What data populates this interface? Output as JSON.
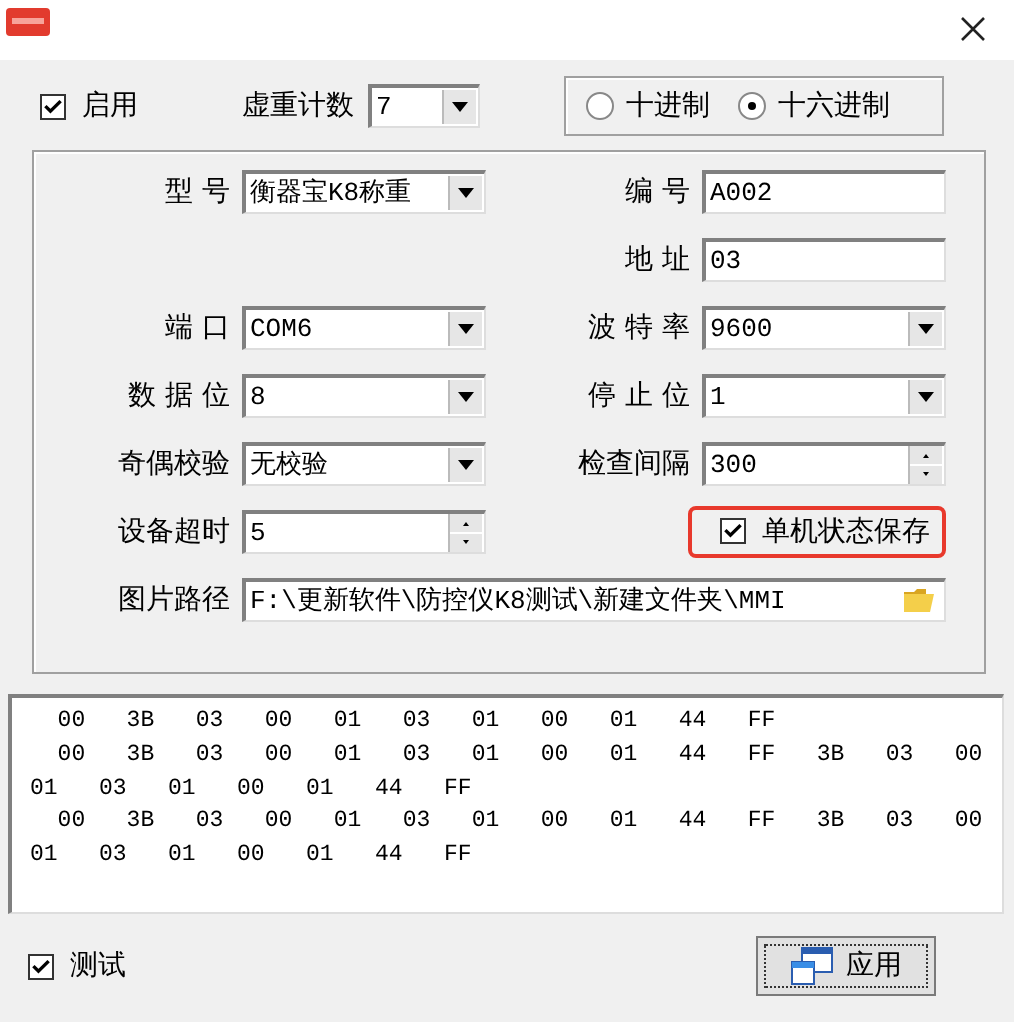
{
  "enable": {
    "label": "启用",
    "checked": true
  },
  "weight_count": {
    "label": "虚重计数",
    "value": "7"
  },
  "radix": [
    {
      "label": "十进制",
      "selected": false
    },
    {
      "label": "十六进制",
      "selected": true
    }
  ],
  "rows": [
    {
      "left": {
        "kind": "select",
        "label": "型 号",
        "value": "衡器宝K8称重"
      },
      "right": {
        "kind": "text",
        "label": "编 号",
        "value": "A002"
      }
    },
    {
      "right": {
        "kind": "text",
        "label": "地 址",
        "value": "03"
      }
    },
    {
      "left": {
        "kind": "select",
        "label": "端 口",
        "value": "COM6"
      },
      "right": {
        "kind": "select",
        "label": "波 特 率",
        "value": "9600"
      }
    },
    {
      "left": {
        "kind": "select",
        "label": "数 据 位",
        "value": "8"
      },
      "right": {
        "kind": "select",
        "label": "停 止 位",
        "value": "1"
      }
    },
    {
      "left": {
        "kind": "select",
        "label": "奇偶校验",
        "value": "无校验"
      },
      "right": {
        "kind": "spin",
        "label": "检查间隔",
        "value": "300"
      }
    },
    {
      "left": {
        "kind": "spin",
        "label": "设备超时",
        "value": "5"
      },
      "right": {
        "kind": "checkbox",
        "label": "单机状态保存",
        "checked": true,
        "highlighted": true
      }
    }
  ],
  "path": {
    "label": "图片路径",
    "value": "F:\\更新软件\\防控仪K8测试\\新建文件夹\\MMI"
  },
  "log_lines": [
    "  00   3B   03   00   01   03   01   00   01   44   FF",
    "  00   3B   03   00   01   03   01   00   01   44   FF   3B   03   00",
    "01   03   01   00   01   44   FF",
    "  00   3B   03   00   01   03   01   00   01   44   FF   3B   03   00",
    "01   03   01   00   01   44   FF"
  ],
  "test": {
    "label": "测试",
    "checked": true
  },
  "apply_button": {
    "label": "应用"
  }
}
